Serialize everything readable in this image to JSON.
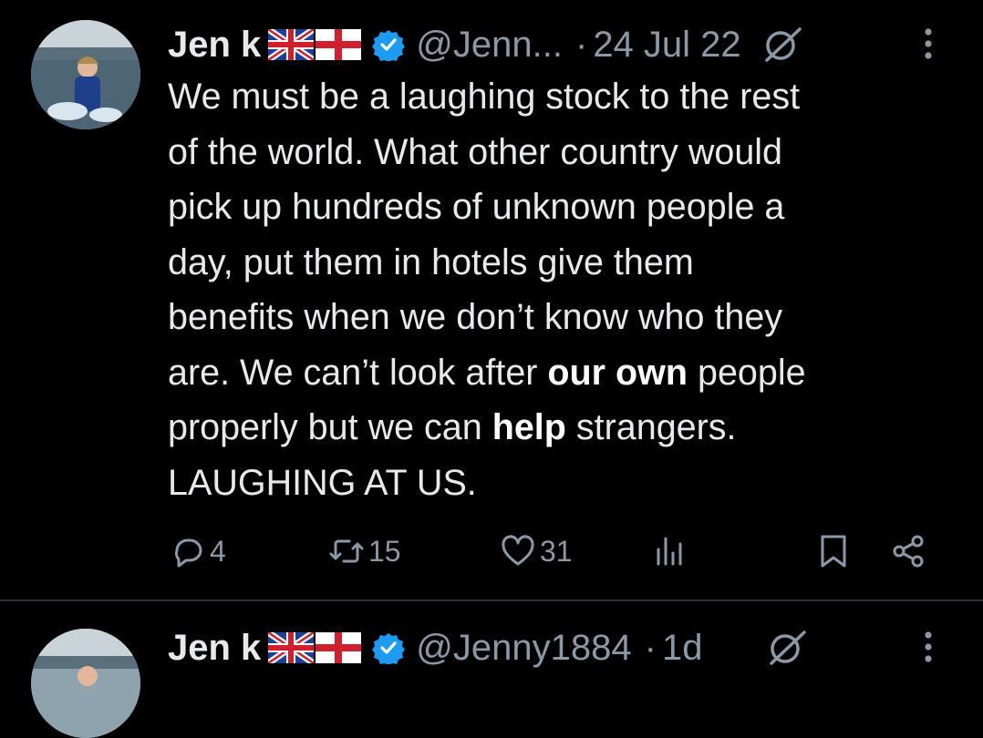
{
  "tweet": {
    "author_name": "Jen k",
    "handle": "@Jenn...",
    "separator": "·",
    "date": "24 Jul 22",
    "body_lines": [
      "We must be a laughing stock to the rest",
      "of the world. What other country would",
      "pick up hundreds of unknown people a",
      "day, put them in hotels give them",
      "benefits when we don’t know who they"
    ],
    "line6_pre": "are. We can’t look after ",
    "line6_bold": "our own",
    "line6_post": " people",
    "line7_pre": "properly but we can ",
    "line7_bold": "help",
    "line7_post": " strangers.",
    "line8": "LAUGHING AT US.",
    "reply_count": "4",
    "retweet_count": "15",
    "like_count": "31"
  },
  "next_tweet": {
    "author_name": "Jen k",
    "handle": "@Jenny1884",
    "separator": "·",
    "date": "1d"
  },
  "colors": {
    "background": "#000000",
    "text": "#e7e9ea",
    "muted": "#8b98a5",
    "verified": "#1d9bf0"
  },
  "icons": [
    "uk-flag-icon",
    "england-flag-icon",
    "verified-badge-icon",
    "grok-icon",
    "more-icon",
    "reply-icon",
    "retweet-icon",
    "like-icon",
    "views-icon",
    "bookmark-icon",
    "share-icon"
  ]
}
